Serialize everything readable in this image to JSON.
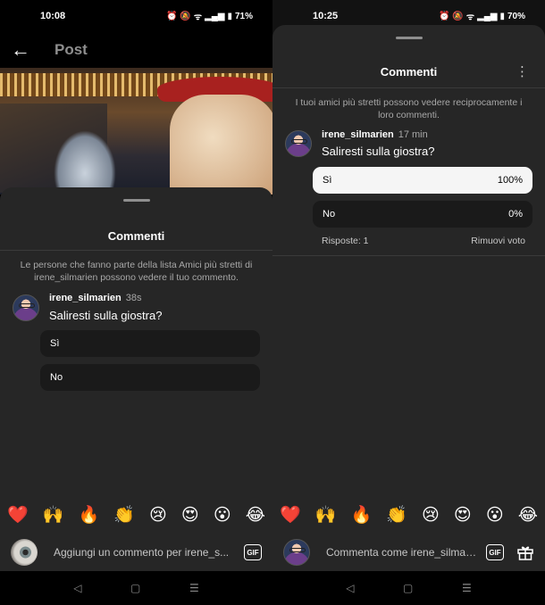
{
  "left": {
    "status": {
      "time": "10:08",
      "battery": "71%"
    },
    "header": {
      "title": "Post"
    },
    "sheet": {
      "title": "Commenti",
      "privacy": "Le persone che fanno parte della lista Amici più stretti di irene_silmarien possono vedere il tuo commento.",
      "comment": {
        "username": "irene_silmarien",
        "time": "38s",
        "text": "Saliresti sulla giostra?"
      },
      "poll": [
        {
          "label": "Sì"
        },
        {
          "label": "No"
        }
      ],
      "emojis": [
        "❤️",
        "🙌",
        "🔥",
        "👏",
        "😢",
        "😍",
        "😮",
        "😂"
      ],
      "input_placeholder": "Aggiungi un commento per irene_s..."
    }
  },
  "right": {
    "status": {
      "time": "10:25",
      "battery": "70%"
    },
    "sheet": {
      "title": "Commenti",
      "privacy": "I tuoi amici più stretti possono vedere reciprocamente i loro commenti.",
      "comment": {
        "username": "irene_silmarien",
        "time": "17 min",
        "text": "Saliresti sulla giostra?"
      },
      "poll": [
        {
          "label": "Sì",
          "percent": "100%"
        },
        {
          "label": "No",
          "percent": "0%"
        }
      ],
      "responses": "Risposte: 1",
      "remove_vote": "Rimuovi voto",
      "emojis": [
        "❤️",
        "🙌",
        "🔥",
        "👏",
        "😢",
        "😍",
        "😮",
        "😂"
      ],
      "input_placeholder": "Commenta come irene_silmarien..."
    }
  },
  "icons": {
    "gif": "GIF",
    "back": "←",
    "more": "⋮",
    "nav_back": "◁",
    "nav_home": "▢",
    "nav_recent": "☰"
  }
}
